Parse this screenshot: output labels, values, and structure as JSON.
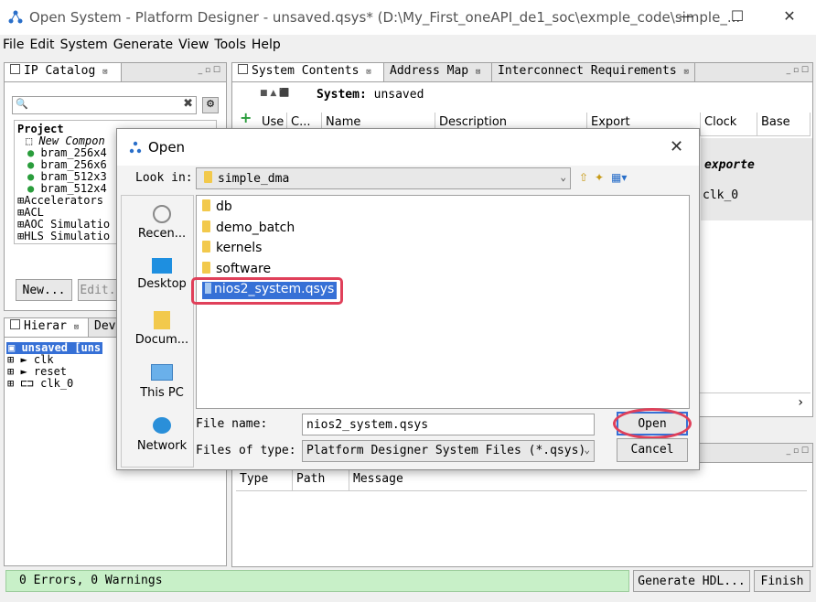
{
  "window": {
    "title": "Open System - Platform Designer - unsaved.qsys* (D:\\My_First_oneAPI_de1_soc\\exmple_code\\simple_...",
    "minimize": "—",
    "maximize": "☐",
    "close": "✕"
  },
  "menu": [
    "File",
    "Edit",
    "System",
    "Generate",
    "View",
    "Tools",
    "Help"
  ],
  "ip_catalog": {
    "tab": "IP Catalog",
    "tree": {
      "project": "Project",
      "new_component": "New Compon",
      "items": [
        "bram_256x4",
        "bram_256x6",
        "bram_512x3",
        "bram_512x4"
      ],
      "groups": [
        "Accelerators",
        "ACL",
        "AOC Simulatio",
        "HLS Simulatio"
      ]
    },
    "new_button": "New...",
    "edit_button": "Edit."
  },
  "hierarchy": {
    "tab_hier": "Hierar",
    "tab_dev": "Dev",
    "root": "unsaved [uns",
    "items": [
      "clk",
      "reset",
      "clk_0"
    ]
  },
  "system_contents": {
    "tabs": [
      "System Contents",
      "Address Map",
      "Interconnect Requirements"
    ],
    "system_label": "System:",
    "system_name": "unsaved",
    "columns": [
      "Use",
      "C...",
      "Name",
      "Description",
      "Export",
      "Clock",
      "Base"
    ],
    "exported_text": "exporte",
    "clock_value": "clk_0"
  },
  "messages": {
    "columns": [
      "Type",
      "Path",
      "Message"
    ]
  },
  "status": {
    "text": "0 Errors, 0 Warnings",
    "generate_button": "Generate HDL...",
    "finish_button": "Finish"
  },
  "dialog": {
    "title": "Open",
    "close": "✕",
    "look_in_label": "Look in:",
    "look_in_value": "simple_dma",
    "places": [
      "Recen...",
      "Desktop",
      "Docum...",
      "This PC",
      "Network"
    ],
    "files": [
      "db",
      "demo_batch",
      "kernels",
      "software",
      "nios2_system.qsys"
    ],
    "file_name_label": "File name:",
    "file_name_value": "nios2_system.qsys",
    "file_type_label": "Files of type:",
    "file_type_value": "Platform Designer System Files (*.qsys)",
    "open_button": "Open",
    "cancel_button": "Cancel"
  },
  "colors": {
    "selection": "#3670d6",
    "highlight_outline": "#e0405a",
    "status_green": "#c8f0c8"
  }
}
